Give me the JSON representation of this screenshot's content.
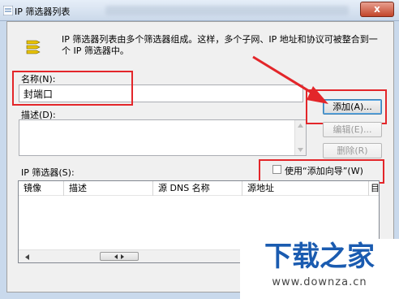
{
  "window": {
    "title": "IP 筛选器列表",
    "close_glyph": "x"
  },
  "description": "IP 筛选器列表由多个筛选器组成。这样，多个子网、IP 地址和协议可被整合到一个 IP 筛选器中。",
  "name_field": {
    "label": "名称(N):",
    "value": "封端口"
  },
  "desc_field": {
    "label": "描述(D):",
    "value": ""
  },
  "buttons": {
    "add": "添加(A)...",
    "edit": "编辑(E)...",
    "delete": "删除(R)"
  },
  "filters": {
    "label": "IP 筛选器(S):",
    "wizard_checkbox": {
      "label": "使用“添加向导”(W)",
      "checked": false
    },
    "columns": [
      "镜像",
      "描述",
      "源 DNS 名称",
      "源地址",
      "目"
    ],
    "rows": []
  },
  "watermark": {
    "name": "下载之家",
    "url": "www.downza.cn"
  },
  "annotation_color": "#e3262a",
  "icons": [
    "filter-list-icon",
    "scroll-left-icon",
    "scroll-right-icon",
    "scroll-thumb-icon",
    "scroll-up-icon",
    "scroll-down-icon"
  ]
}
